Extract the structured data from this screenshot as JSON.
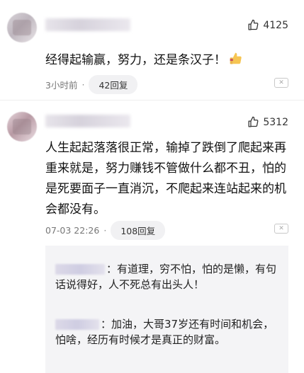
{
  "comments": [
    {
      "likes": "4125",
      "text": "经得起输赢，努力，还是条汉子！",
      "time": "3小时前",
      "replies": "42回复"
    },
    {
      "likes": "5312",
      "text": "人生起起落落很正常，输掉了跌倒了爬起来再重来就是，努力赚钱不管做什么都不丑，怕的是死要面子一直消沉，不爬起来连站起来的机会都没有。",
      "time": "07-03 22:26",
      "replies": "108回复"
    }
  ],
  "replies": [
    {
      "text": "：有道理，穷不怕，怕的是懒，有句话说得好，人不死总有出头人！"
    },
    {
      "text": "：加油，大哥37岁还有时间和机会，怕啥，经历有时候才是真正的财富。"
    }
  ],
  "icons": {
    "like": "thumbs-up-icon",
    "emoji": "thumbs-up-emoji",
    "report": "close-icon"
  }
}
